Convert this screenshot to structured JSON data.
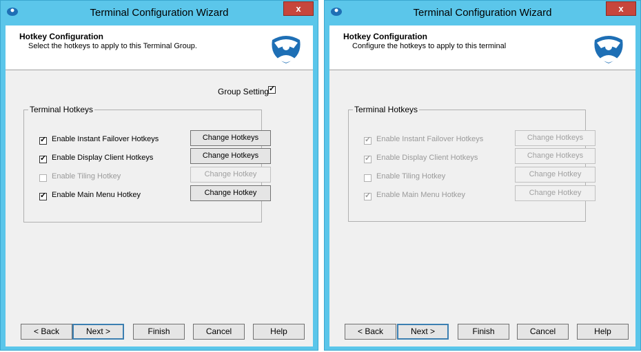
{
  "left_window": {
    "title": "Terminal Configuration Wizard",
    "close_label": "x",
    "header": {
      "title": "Hotkey Configuration",
      "subtitle": "Select the hotkeys to apply to this Terminal Group."
    },
    "group_setting": {
      "label": "Group Setting",
      "checked": true
    },
    "group_label": "Terminal Hotkeys",
    "hotkeys": [
      {
        "label": "Enable Instant Failover Hotkeys",
        "checked": true,
        "enabled": true,
        "button": "Change Hotkeys",
        "button_enabled": true
      },
      {
        "label": "Enable Display Client Hotkeys",
        "checked": true,
        "enabled": true,
        "button": "Change Hotkeys",
        "button_enabled": true
      },
      {
        "label": "Enable Tiling Hotkey",
        "checked": false,
        "enabled": false,
        "button": "Change Hotkey",
        "button_enabled": false
      },
      {
        "label": "Enable Main Menu Hotkey",
        "checked": true,
        "enabled": true,
        "button": "Change Hotkey",
        "button_enabled": true
      }
    ],
    "buttons": {
      "back": "< Back",
      "next": "Next >",
      "finish": "Finish",
      "cancel": "Cancel",
      "help": "Help"
    }
  },
  "right_window": {
    "title": "Terminal Configuration Wizard",
    "close_label": "x",
    "header": {
      "title": "Hotkey Configuration",
      "subtitle": "Configure the hotkeys to apply to this terminal"
    },
    "group_label": "Terminal Hotkeys",
    "hotkeys": [
      {
        "label": "Enable Instant Failover Hotkeys",
        "checked": true,
        "enabled": false,
        "button": "Change Hotkeys",
        "button_enabled": false
      },
      {
        "label": "Enable Display Client Hotkeys",
        "checked": true,
        "enabled": false,
        "button": "Change Hotkeys",
        "button_enabled": false
      },
      {
        "label": "Enable Tiling Hotkey",
        "checked": false,
        "enabled": false,
        "button": "Change Hotkey",
        "button_enabled": false
      },
      {
        "label": "Enable Main Menu Hotkey",
        "checked": true,
        "enabled": false,
        "button": "Change Hotkey",
        "button_enabled": false
      }
    ],
    "buttons": {
      "back": "< Back",
      "next": "Next >",
      "finish": "Finish",
      "cancel": "Cancel",
      "help": "Help"
    }
  },
  "colors": {
    "title_bar": "#5bc6ea",
    "close_button": "#c7463c",
    "dialog_bg": "#f0f0f0",
    "logo_blue": "#1e6fb5"
  },
  "icons": {
    "system": "thinmanager-icon",
    "logo": "thinmanager-logo"
  }
}
